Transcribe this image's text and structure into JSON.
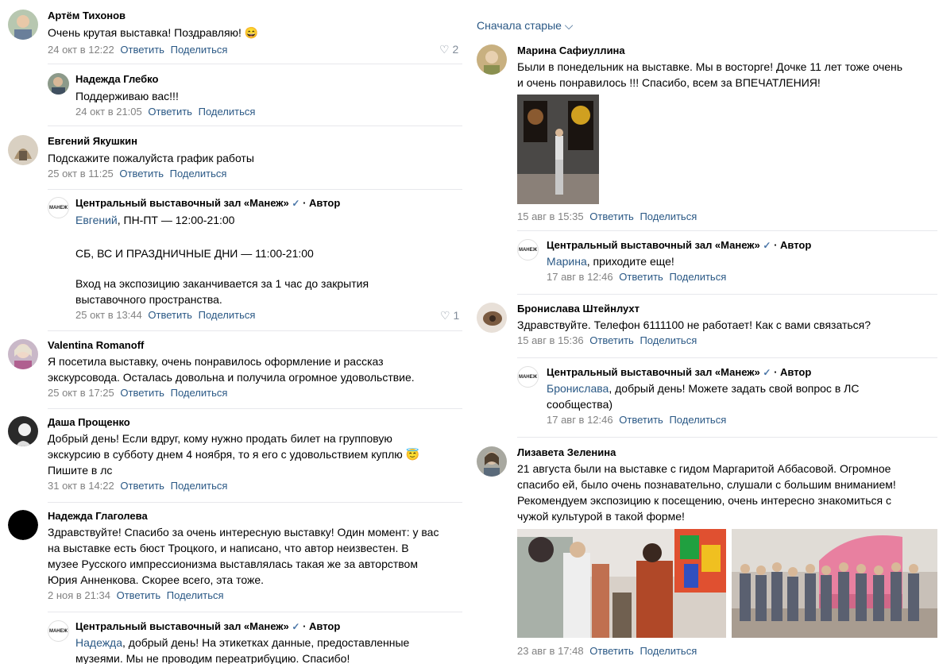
{
  "sort": {
    "label": "Сначала старые ⌵"
  },
  "common": {
    "reply": "Ответить",
    "share": "Поделиться",
    "author_tag": "· Автор",
    "verified": "✓"
  },
  "left": [
    {
      "author": "Артём Тихонов",
      "text": "Очень крутая выставка! Поздравляю! 😄",
      "date": "24 окт в 12:22",
      "likes": "♡ 2"
    },
    {
      "author": "Надежда Глебко",
      "text": "Поддерживаю вас!!!",
      "date": "24 окт в 21:05"
    },
    {
      "author": "Евгений Якушкин",
      "text": "Подскажите пожалуйста график работы",
      "date": "25 окт в 11:25"
    },
    {
      "author": "Центральный выставочный зал «Манеж»",
      "mention": "Евгений",
      "line1": ", ПН-ПТ — 12:00-21:00",
      "line2": "СБ, ВС И ПРАЗДНИЧНЫЕ ДНИ — 11:00-21:00",
      "line3": "Вход на экспозицию заканчивается за 1 час до закрытия",
      "line4": "выставочного пространства.",
      "date": "25 окт в 13:44",
      "likes": "♡ 1"
    },
    {
      "author": "Valentina Romanoff",
      "line1": "Я посетила выставку, очень понравилось оформление и рассказ",
      "line2": "экскурсовода. Осталась довольна и получила огромное удовольствие.",
      "date": "25 окт в 17:25"
    },
    {
      "author": "Даша Прощенко",
      "line1": "Добрый день! Если вдруг, кому нужно продать билет на групповую",
      "line2": "экскурсию в субботу днем 4 ноября, то я его с удовольствием куплю 😇",
      "line3": "Пишите в лс",
      "date": "31 окт в 14:22"
    },
    {
      "author": "Надежда Глаголева",
      "line1": "Здравствуйте! Спасибо за очень интересную выставку! Один момент: у вас",
      "line2": "на выставке есть бюст Троцкого, и написано, что автор неизвестен. В",
      "line3": "музее Русского импрессионизма выставлялась такая же за авторством",
      "line4": "Юрия Анненкова. Скорее всего, эта тоже.",
      "date": "2 ноя в 21:34"
    },
    {
      "author": "Центральный выставочный зал «Манеж»",
      "mention": "Надежда",
      "line1": ", добрый день! На этикетках данные, предоставленные",
      "line2": "музеями. Мы не проводим переатрибуцию. Спасибо!"
    }
  ],
  "right": [
    {
      "author": "Марина Сафиуллина",
      "line1": "Были в понедельник на выставке. Мы в восторге! Дочке 11 лет тоже очень",
      "line2": "и очень понравилось !!! Спасибо, всем за ВПЕЧАТЛЕНИЯ!",
      "date": "15 авг в 15:35"
    },
    {
      "author": "Центральный выставочный зал «Манеж»",
      "mention": "Марина",
      "line1": ", приходите еще!",
      "date": "17 авг в 12:46"
    },
    {
      "author": "Бронислава Штейнлухт",
      "text": "Здравствуйте. Телефон 6111100 не работает! Как с вами связаться?",
      "date": "15 авг в 15:36"
    },
    {
      "author": "Центральный выставочный зал «Манеж»",
      "mention": "Бронислава",
      "line1": ", добрый день! Можете задать свой вопрос в ЛС",
      "line2": "сообщества)",
      "date": "17 авг в 12:46"
    },
    {
      "author": "Лизавета Зеленина",
      "line1": "21 августа были на выставке с гидом Маргаритой Аббасовой. Огромное",
      "line2": "спасибо ей, было очень познавательно, слушали с большим вниманием!",
      "line3": "Рекомендуем экспозицию к посещению, очень интересно знакомиться с",
      "line4": "чужой культурой в такой форме!",
      "date": "23 авг в 17:48"
    }
  ],
  "logo_text": "МАНЕЖ"
}
